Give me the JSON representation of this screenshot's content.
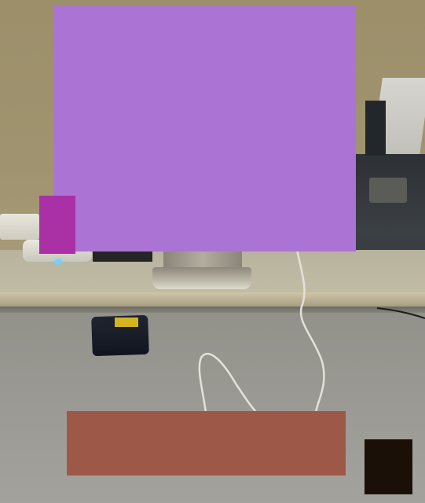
{
  "scene": {
    "type": "photo",
    "subject": "desk",
    "colors": {
      "wall": "#9c8f6a",
      "desk": "#bdb7a2",
      "floor": "#9b9a94",
      "mask_monitor": "#ab74d4",
      "mask_small": "#aa30a6",
      "mask_bottom": "#9e5848",
      "mask_dark": "#1b1008"
    }
  }
}
